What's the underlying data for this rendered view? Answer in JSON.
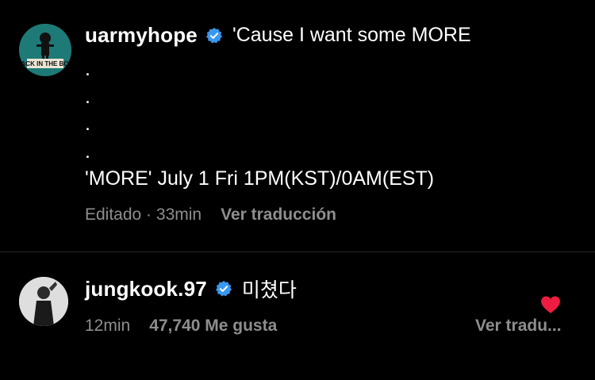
{
  "post": {
    "username": "uarmyhope",
    "caption_first_line": "'Cause I want some MORE",
    "dots": [
      ".",
      ".",
      ".",
      "."
    ],
    "caption_last_line": "'MORE' July 1 Fri 1PM(KST)/0AM(EST)",
    "edited_label": "Editado · 33min",
    "translate_label": "Ver traducción",
    "avatar_text": "JACK IN THE BOX"
  },
  "comment": {
    "username": "jungkook.97",
    "text": "미쳤다",
    "time": "12min",
    "likes": "47,740 Me gusta",
    "translate_label": "Ver tradu...",
    "liked": true
  },
  "colors": {
    "background": "#000000",
    "text": "#ffffff",
    "muted": "#8e8e8e",
    "verified": "#3897f0",
    "heart": "#ed1c40"
  },
  "icons": {
    "verified": "verified-badge-icon",
    "heart": "heart-filled-icon"
  }
}
